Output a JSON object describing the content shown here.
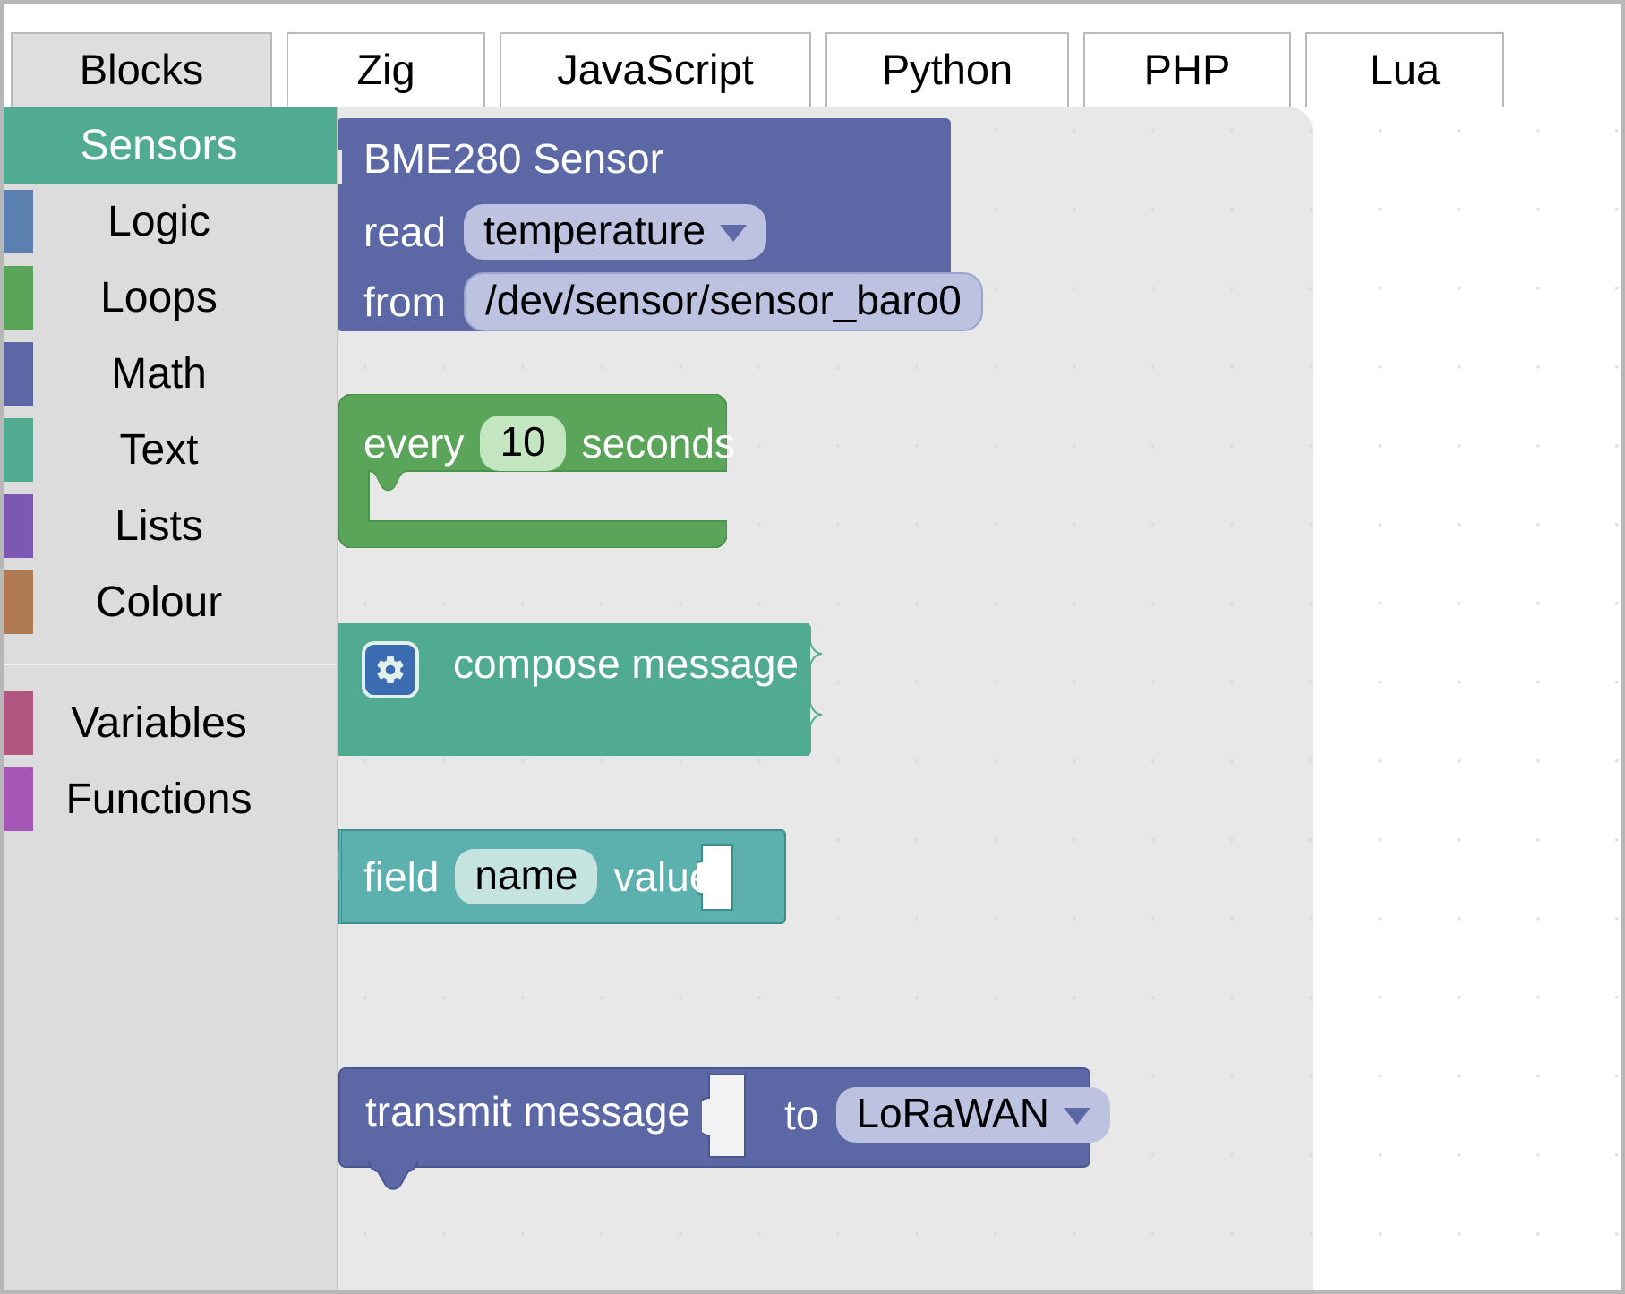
{
  "tabs": [
    {
      "label": "Blocks",
      "active": true
    },
    {
      "label": "Zig",
      "active": false
    },
    {
      "label": "JavaScript",
      "active": false
    },
    {
      "label": "Python",
      "active": false
    },
    {
      "label": "PHP",
      "active": false
    },
    {
      "label": "Lua",
      "active": false
    }
  ],
  "toolbox": {
    "items": [
      {
        "label": "Sensors",
        "colour": "#51ab91",
        "selected": true
      },
      {
        "label": "Logic",
        "colour": "#5b80b0",
        "selected": false
      },
      {
        "label": "Loops",
        "colour": "#5ba55b",
        "selected": false
      },
      {
        "label": "Math",
        "colour": "#5b68a5",
        "selected": false
      },
      {
        "label": "Text",
        "colour": "#51ab91",
        "selected": false
      },
      {
        "label": "Lists",
        "colour": "#7c58b5",
        "selected": false
      },
      {
        "label": "Colour",
        "colour": "#b07a52",
        "selected": false
      },
      {
        "label": "Variables",
        "colour": "#b1577f",
        "selected": false
      },
      {
        "label": "Functions",
        "colour": "#a457b5",
        "selected": false
      }
    ]
  },
  "blocks": {
    "sensor": {
      "title": "BME280 Sensor",
      "read_label": "read",
      "read_value": "temperature",
      "from_label": "from",
      "from_value": "/dev/sensor/sensor_baro0",
      "colour": "#5b68a5"
    },
    "loop": {
      "every_label": "every",
      "interval_value": "10",
      "seconds_label": "seconds",
      "colour": "#5ba55b"
    },
    "compose": {
      "gear_icon": "gear-icon",
      "label": "compose message",
      "colour": "#51ab91"
    },
    "field": {
      "field_label": "field",
      "name_value": "name",
      "value_label": "value",
      "colour": "#5cb0ae"
    },
    "transmit": {
      "label": "transmit message",
      "to_label": "to",
      "target_value": "LoRaWAN",
      "colour": "#5b68a5"
    }
  }
}
